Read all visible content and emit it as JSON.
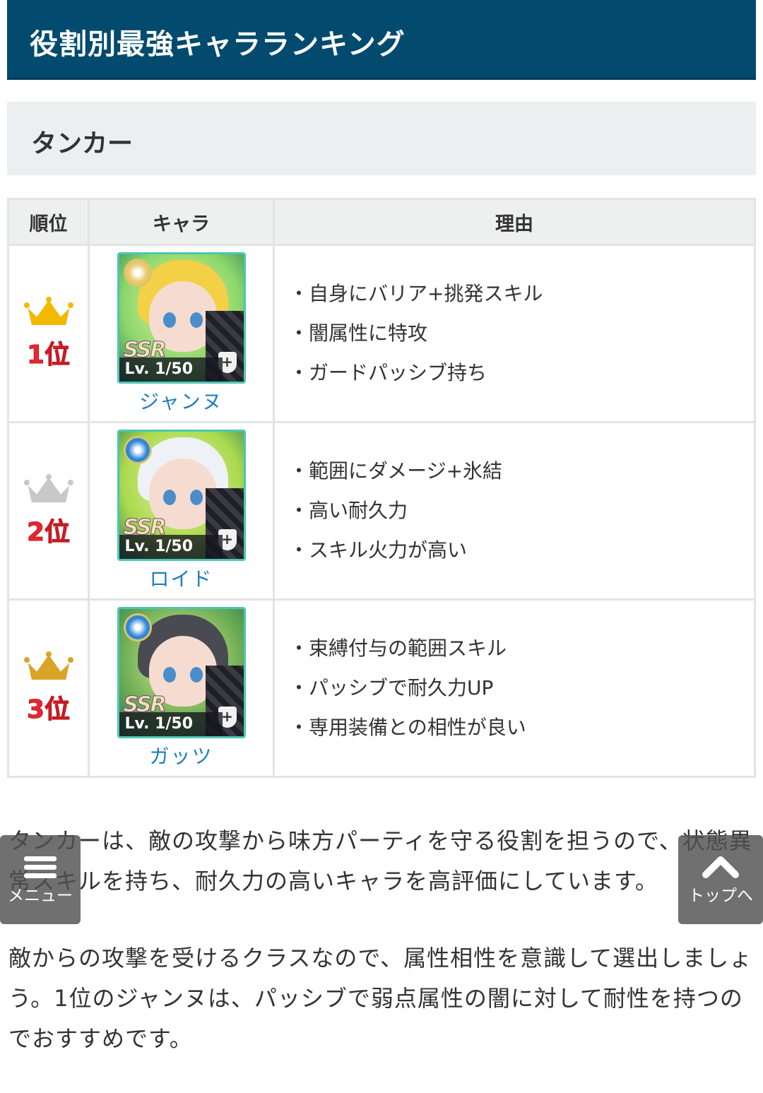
{
  "header": {
    "title": "役割別最強キャラランキング"
  },
  "section": {
    "title": "タンカー"
  },
  "table": {
    "headers": {
      "rank": "順位",
      "character": "キャラ",
      "reason": "理由"
    },
    "rows": [
      {
        "rank": "1位",
        "crown_color": "#f2b900",
        "name": "ジャンヌ",
        "portrait_bg": "#8bd66a",
        "hair_color": "#f4d046",
        "element_color": "#e9c86a",
        "level": "Lv. 1/50",
        "rarity": "SSR",
        "reasons": [
          "・自身にバリア+挑発スキル",
          "・闇属性に特攻",
          "・ガードパッシブ持ち"
        ]
      },
      {
        "rank": "2位",
        "crown_color": "#c8c8c8",
        "name": "ロイド",
        "portrait_bg": "#a9d94e",
        "hair_color": "#eef2f6",
        "element_color": "#2f86d8",
        "level": "Lv. 1/50",
        "rarity": "SSR",
        "reasons": [
          "・範囲にダメージ+氷結",
          "・高い耐久力",
          "・スキル火力が高い"
        ]
      },
      {
        "rank": "3位",
        "crown_color": "#d9a428",
        "name": "ガッツ",
        "portrait_bg": "#6fae54",
        "hair_color": "#4a4a52",
        "element_color": "#2f86d8",
        "level": "Lv. 1/50",
        "rarity": "SSR",
        "reasons": [
          "・束縛付与の範囲スキル",
          "・パッシブで耐久力UP",
          "・専用装備との相性が良い"
        ]
      }
    ]
  },
  "body_text": {
    "p1": "タンカーは、敵の攻撃から味方パーティを守る役割を担うので、状態異常スキルを持ち、耐久力の高いキャラを高評価にしています。",
    "p2": "敵からの攻撃を受けるクラスなので、属性相性を意識して選出しましょう。1位のジャンヌは、パッシブで弱点属性の闇に対して耐性を持つのでおすすめです。"
  },
  "floating": {
    "menu_label": "メニュー",
    "top_label": "トップへ"
  }
}
